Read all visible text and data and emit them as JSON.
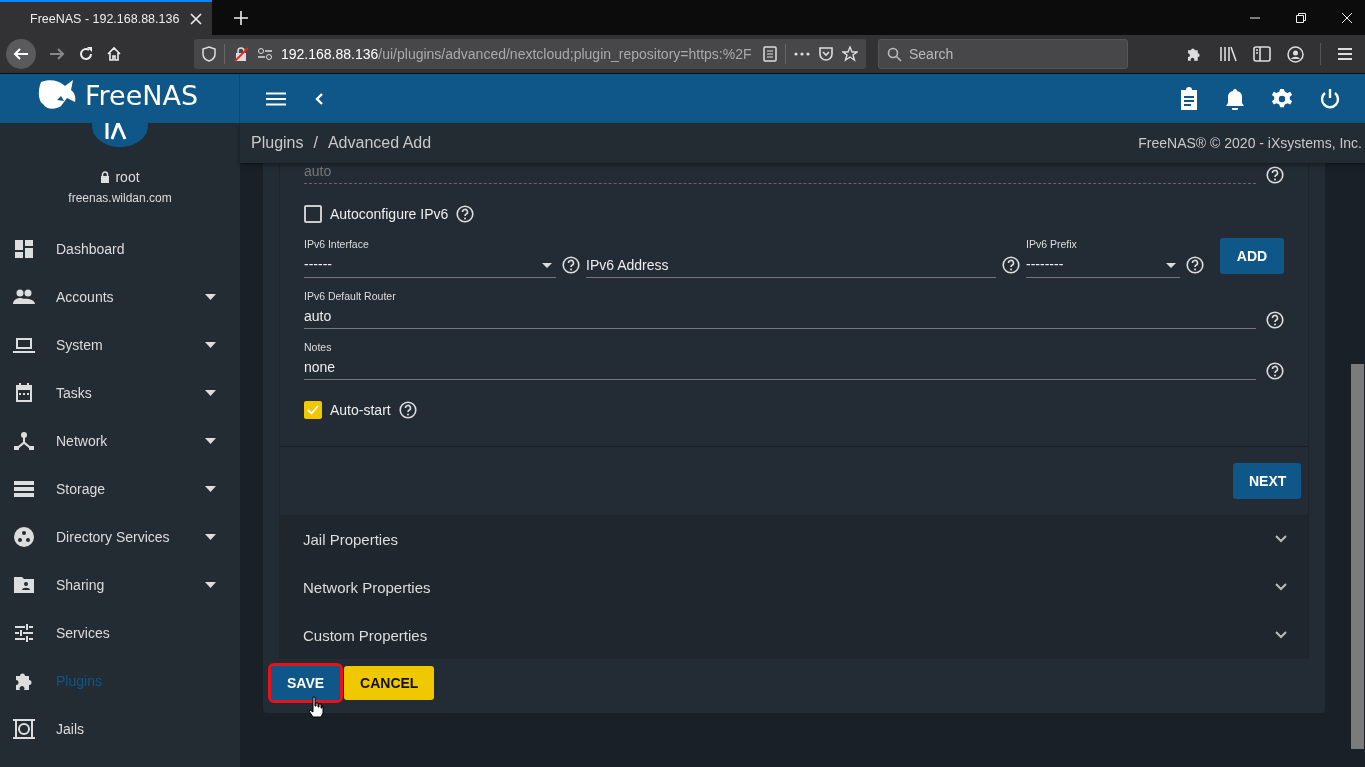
{
  "browser": {
    "tab_title": "FreeNAS - 192.168.88.136",
    "url_host": "192.168.88.136",
    "url_path": "/ui/plugins/advanced/nextcloud;plugin_repository=https:%2F",
    "search_placeholder": "Search"
  },
  "header": {
    "logo": "FreeNAS"
  },
  "user": {
    "name": "root",
    "host": "freenas.wildan.com"
  },
  "sidebar": {
    "items": [
      {
        "label": "Dashboard",
        "expandable": false,
        "selected": false
      },
      {
        "label": "Accounts",
        "expandable": true,
        "selected": false
      },
      {
        "label": "System",
        "expandable": true,
        "selected": false
      },
      {
        "label": "Tasks",
        "expandable": true,
        "selected": false
      },
      {
        "label": "Network",
        "expandable": true,
        "selected": false
      },
      {
        "label": "Storage",
        "expandable": true,
        "selected": false
      },
      {
        "label": "Directory Services",
        "expandable": true,
        "selected": false
      },
      {
        "label": "Sharing",
        "expandable": true,
        "selected": false
      },
      {
        "label": "Services",
        "expandable": false,
        "selected": false
      },
      {
        "label": "Plugins",
        "expandable": false,
        "selected": true
      },
      {
        "label": "Jails",
        "expandable": false,
        "selected": false
      }
    ]
  },
  "breadcrumb": {
    "parent": "Plugins",
    "separator": "/",
    "current": "Advanced Add"
  },
  "copyright": "FreeNAS® © 2020 - iXsystems, Inc.",
  "form": {
    "rows": [
      {
        "kind": "input",
        "value": "auto",
        "disabled": true
      },
      {
        "kind": "checkbox",
        "label": "Autoconfigure IPv6",
        "checked": false
      },
      {
        "kind": "ipv6",
        "interface_label": "IPv6 Interface",
        "interface_value": "------",
        "address_placeholder": "IPv6 Address",
        "prefix_label": "IPv6 Prefix",
        "prefix_value": "--------",
        "button": "ADD"
      },
      {
        "kind": "input",
        "label": "IPv6 Default Router",
        "value": "auto",
        "disabled": false
      },
      {
        "kind": "input",
        "label": "Notes",
        "value": "none",
        "disabled": false
      },
      {
        "kind": "checkbox",
        "label": "Auto-start",
        "checked": true
      }
    ],
    "next_button": "NEXT"
  },
  "sections": [
    {
      "title": "Jail Properties",
      "expanded": false
    },
    {
      "title": "Network Properties",
      "expanded": false
    },
    {
      "title": "Custom Properties",
      "expanded": false
    }
  ],
  "actions": [
    {
      "label": "SAVE",
      "kind": "primary",
      "focused": true
    },
    {
      "label": "CANCEL",
      "kind": "warning",
      "focused": false
    }
  ]
}
